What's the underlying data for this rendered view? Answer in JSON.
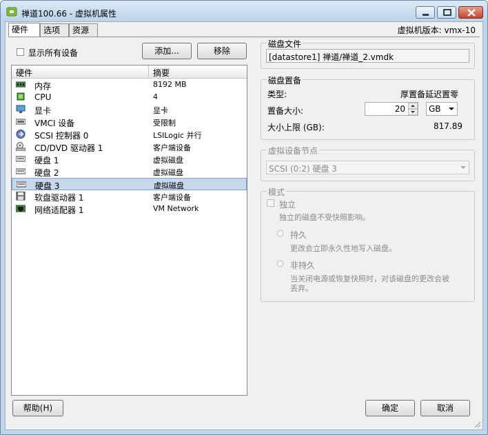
{
  "window": {
    "title": "禅道100.66 - 虚拟机属性"
  },
  "tabs": [
    {
      "label": "硬件",
      "active": true
    },
    {
      "label": "选项",
      "active": false
    },
    {
      "label": "资源",
      "active": false
    }
  ],
  "version_label": "虚拟机版本: vmx-10",
  "show_all_devices": {
    "label": "显示所有设备",
    "checked": false
  },
  "buttons": {
    "add": "添加...",
    "remove": "移除",
    "help": "帮助(H)",
    "ok": "确定",
    "cancel": "取消"
  },
  "hardware": {
    "headers": {
      "hardware": "硬件",
      "summary": "摘要"
    },
    "rows": [
      {
        "name": "内存",
        "summary": "8192 MB",
        "icon": "memory-icon"
      },
      {
        "name": "CPU",
        "summary": "4",
        "icon": "cpu-icon"
      },
      {
        "name": "显卡",
        "summary": "显卡",
        "icon": "display-icon"
      },
      {
        "name": "VMCI 设备",
        "summary": "受限制",
        "icon": "vmci-icon"
      },
      {
        "name": "SCSI 控制器 0",
        "summary": "LSILogic 并行",
        "icon": "scsi-icon"
      },
      {
        "name": "CD/DVD 驱动器 1",
        "summary": "客户端设备",
        "icon": "cdrom-icon"
      },
      {
        "name": "硬盘 1",
        "summary": "虚拟磁盘",
        "icon": "disk-icon"
      },
      {
        "name": "硬盘 2",
        "summary": "虚拟磁盘",
        "icon": "disk-icon"
      },
      {
        "name": "硬盘 3",
        "summary": "虚拟磁盘",
        "icon": "disk-icon",
        "selected": true
      },
      {
        "name": "软盘驱动器 1",
        "summary": "客户端设备",
        "icon": "floppy-icon"
      },
      {
        "name": "网络适配器 1",
        "summary": "VM Network",
        "icon": "network-icon"
      }
    ]
  },
  "disk_file": {
    "label": "磁盘文件",
    "value": "[datastore1] 禅道/禅道_2.vmdk"
  },
  "provisioning": {
    "label": "磁盘置备",
    "type_label": "类型:",
    "type_value": "厚置备延迟置零",
    "size_label": "置备大小:",
    "size_value": "20",
    "unit_value": "GB",
    "max_label": "大小上限 (GB):",
    "max_value": "817.89"
  },
  "virtual_device_node": {
    "label": "虚拟设备节点",
    "value": "SCSI (0:2) 硬盘 3"
  },
  "mode": {
    "label": "模式",
    "independent_label": "独立",
    "independent_desc": "独立的磁盘不受快照影响。",
    "persistent_label": "持久",
    "persistent_desc": "更改会立即永久性地写入磁盘。",
    "nonpersistent_label": "非持久",
    "nonpersistent_desc_1": "当关闭电源或恢复快照时，对该磁盘的更改会被",
    "nonpersistent_desc_2": "丢弃。"
  }
}
